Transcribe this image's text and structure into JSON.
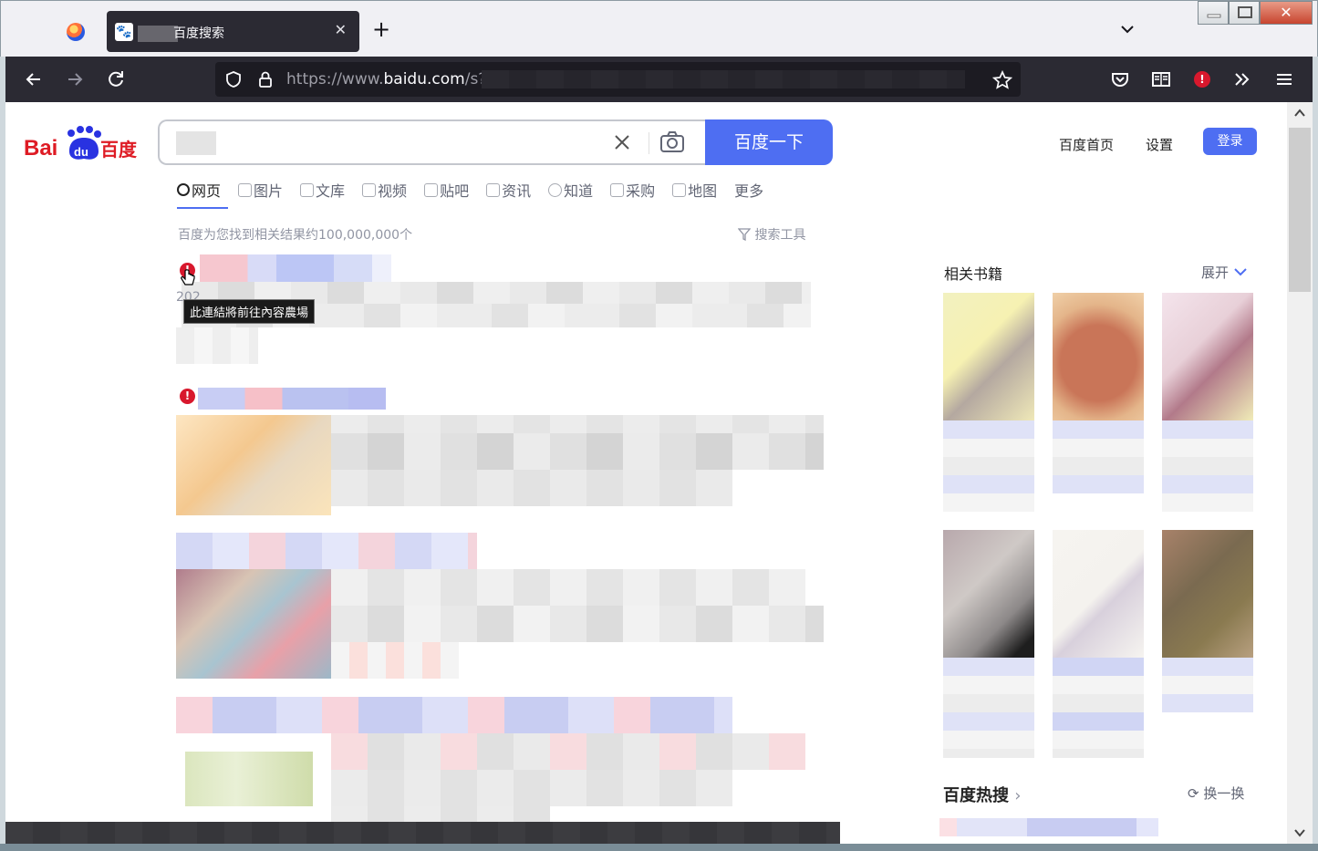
{
  "browser": {
    "tab_title": "百度搜索",
    "tab_close": "✕",
    "new_tab": "+",
    "url_prefix": "https://www.",
    "url_domain": "baidu.com",
    "url_path": "/s?"
  },
  "page": {
    "logo_text": "Bai百度",
    "search_button": "百度一下",
    "top_links": [
      "百度首页",
      "设置"
    ],
    "login": "登录",
    "tabs": [
      "网页",
      "图片",
      "文库",
      "视频",
      "贴吧",
      "资讯",
      "知道",
      "采购",
      "地图",
      "更多"
    ],
    "result_count": "百度为您找到相关结果约100,000,000个",
    "search_tools": "搜索工具",
    "tooltip": "此連結將前往內容農場",
    "tooltip_year": "202",
    "sidebar": {
      "books_title": "相关书籍",
      "books_expand": "展开",
      "hot_title": "百度热搜",
      "hot_refresh": "换一换"
    }
  },
  "colors": {
    "brand_blue": "#4e6ef2",
    "warning_red": "#d8182d",
    "chrome_dark": "#2b2a33"
  }
}
